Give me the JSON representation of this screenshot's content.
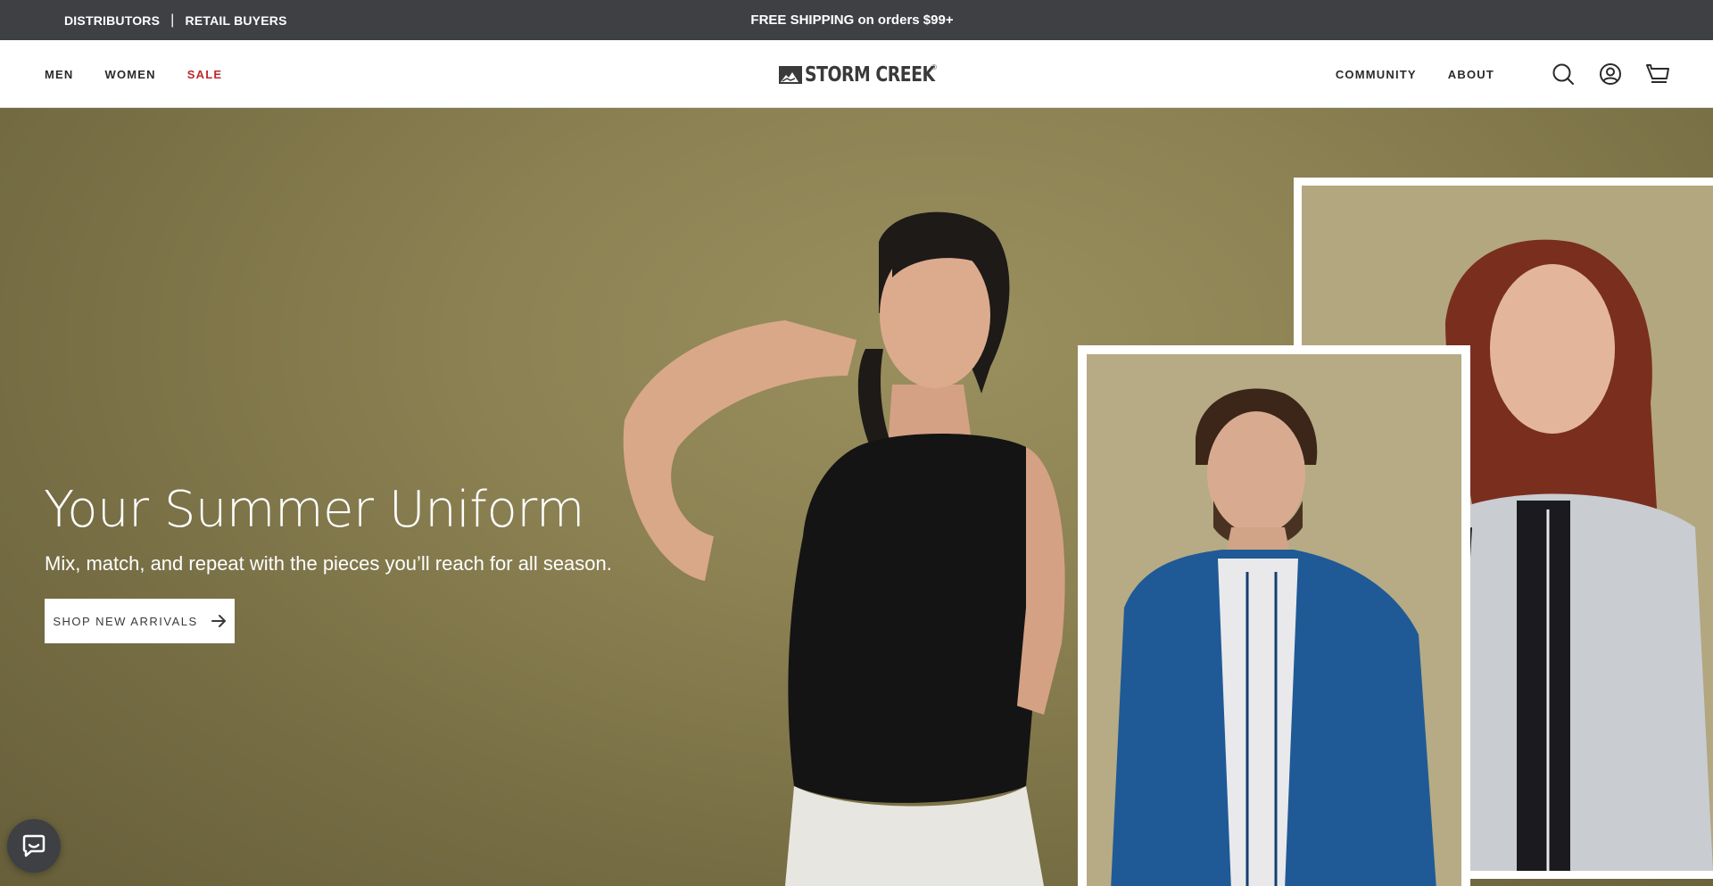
{
  "announcement": {
    "distributors": "DISTRIBUTORS",
    "separator": "|",
    "retail_buyers": "RETAIL BUYERS",
    "shipping": "FREE SHIPPING on orders $99+"
  },
  "nav": {
    "men": "MEN",
    "women": "WOMEN",
    "sale": "SALE",
    "community": "COMMUNITY",
    "about": "ABOUT"
  },
  "logo": {
    "text": "STORM CREEK",
    "registered": "®"
  },
  "icons": {
    "search": "search-icon",
    "account": "account-icon",
    "cart": "cart-icon",
    "chat": "chat-icon",
    "arrow": "arrow-right-icon"
  },
  "hero": {
    "title": "Your Summer Uniform",
    "subtitle": "Mix, match, and repeat with the pieces you’ll reach for all season.",
    "cta": "SHOP NEW ARRIVALS"
  },
  "colors": {
    "announcement_bg": "#3e4044",
    "sale_red": "#c0282d",
    "hero_olive": "#8b8152"
  }
}
